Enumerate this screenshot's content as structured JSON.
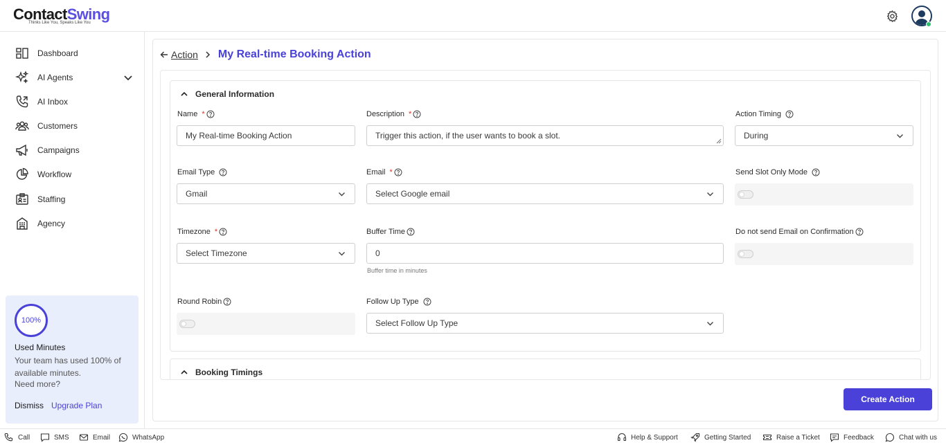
{
  "app": {
    "logo_part1": "Contact",
    "logo_part2": "Swing",
    "tagline": "Thinks Like You, Speaks Like You"
  },
  "colors": {
    "accent": "#4a42d8",
    "required": "#d93025",
    "online": "#2fbf6b"
  },
  "sidebar": {
    "items": [
      {
        "label": "Dashboard",
        "icon": "dashboard-icon"
      },
      {
        "label": "AI Agents",
        "icon": "sparkles-icon"
      },
      {
        "label": "AI Inbox",
        "icon": "phone-inbox-icon"
      },
      {
        "label": "Customers",
        "icon": "users-icon"
      },
      {
        "label": "Campaigns",
        "icon": "megaphone-icon"
      },
      {
        "label": "Workflow",
        "icon": "pie-chart-icon"
      },
      {
        "label": "Staffing",
        "icon": "id-badge-icon"
      },
      {
        "label": "Agency",
        "icon": "building-icon"
      }
    ],
    "usage": {
      "percent_text": "100%",
      "title": "Used Minutes",
      "text": "Your team has used 100% of available minutes.",
      "more": "Need more?",
      "dismiss": "Dismiss",
      "upgrade": "Upgrade Plan"
    }
  },
  "breadcrumb": {
    "back": "Action",
    "title": "My Real-time Booking Action"
  },
  "general": {
    "title": "General Information",
    "name_label": "Name",
    "name_value": "My Real-time Booking Action",
    "description_label": "Description",
    "description_value": "Trigger this action, if the user wants to book a slot.",
    "timing_label": "Action Timing",
    "timing_value": "During",
    "email_type_label": "Email Type",
    "email_type_value": "Gmail",
    "email_label": "Email",
    "email_placeholder": "Select Google email",
    "slot_mode_label": "Send Slot Only Mode",
    "timezone_label": "Timezone",
    "timezone_placeholder": "Select Timezone",
    "buffer_label": "Buffer Time",
    "buffer_value": "0",
    "buffer_hint": "Buffer time in minutes",
    "no_email_label": "Do not send Email on Confirmation",
    "round_robin_label": "Round Robin",
    "follow_up_label": "Follow Up Type",
    "follow_up_placeholder": "Select Follow Up Type",
    "required_mark": "*"
  },
  "booking": {
    "title": "Booking Timings"
  },
  "create_button": "Create Action",
  "footer": {
    "call": "Call",
    "sms": "SMS",
    "email": "Email",
    "whatsapp": "WhatsApp",
    "help": "Help & Support",
    "getting_started": "Getting Started",
    "ticket": "Raise a Ticket",
    "feedback": "Feedback",
    "chat": "Chat with us"
  }
}
